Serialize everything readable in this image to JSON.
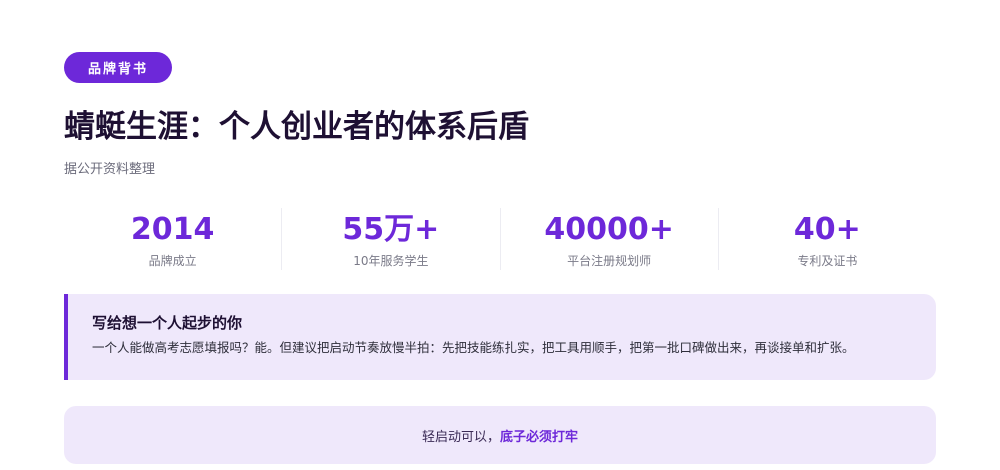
{
  "header": {
    "badge": "品牌背书",
    "title": "蜻蜓生涯：个人创业者的体系后盾",
    "subtitle": "据公开资料整理"
  },
  "stats": [
    {
      "value": "2014",
      "label": "品牌成立"
    },
    {
      "value": "55万+",
      "label": "10年服务学生"
    },
    {
      "value": "40000+",
      "label": "平台注册规划师"
    },
    {
      "value": "40+",
      "label": "专利及证书"
    }
  ],
  "note": {
    "title": "写给想一个人起步的你",
    "body": "一个人能做高考志愿填报吗？能。但建议把启动节奏放慢半拍：先把技能练扎实，把工具用顺手，把第一批口碑做出来，再谈接单和扩张。"
  },
  "cta": {
    "prefix": "轻启动可以，",
    "emphasis": "底子必须打牢"
  },
  "colors": {
    "accent": "#6d28d9",
    "panel_bg": "#efe8fb",
    "title": "#1e1033"
  }
}
